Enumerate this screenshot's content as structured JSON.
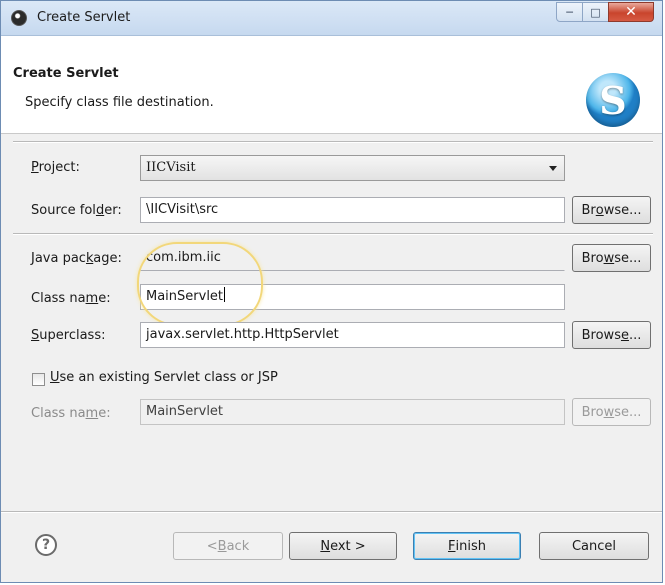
{
  "window": {
    "title": "Create Servlet"
  },
  "banner": {
    "title": "Create Servlet",
    "subtitle": "Specify class file destination.",
    "logo_letter": "S"
  },
  "form": {
    "project_label_pre": "",
    "project_label_u": "P",
    "project_label_post": "roject:",
    "project_value": "IICVisit",
    "source_folder_label_pre": "Source fol",
    "source_folder_label_u": "d",
    "source_folder_label_post": "er:",
    "source_folder_value": "\\IICVisit\\src",
    "java_package_label_pre": "Java pac",
    "java_package_label_u": "k",
    "java_package_label_post": "age:",
    "java_package_value": "com.ibm.iic",
    "class_name_label_pre": "Class na",
    "class_name_label_u": "m",
    "class_name_label_post": "e:",
    "class_name_value": "MainServlet",
    "superclass_label_pre": "",
    "superclass_label_u": "S",
    "superclass_label_post": "uperclass:",
    "superclass_value": "javax.servlet.http.HttpServlet",
    "existing_checkbox_label_u": "U",
    "existing_checkbox_label_post": "se an existing Servlet class or JSP",
    "existing_class_label_pre": "Class na",
    "existing_class_label_u": "m",
    "existing_class_label_post": "e:",
    "existing_class_value": "MainServlet",
    "browse_pre": "Br",
    "browse_u": "o",
    "browse_post": "wse...",
    "browse2_pre": "Bro",
    "browse2_u": "w",
    "browse2_post": "se...",
    "browse3_pre": "Brows",
    "browse3_u": "e",
    "browse3_post": "..."
  },
  "footer": {
    "help_glyph": "?",
    "back_pre": "< ",
    "back_u": "B",
    "back_post": "ack",
    "next_u": "N",
    "next_post": "ext >",
    "finish_u": "F",
    "finish_post": "inish",
    "cancel": "Cancel"
  },
  "colors": {
    "accent": "#3c7fb1",
    "highlight": "#f2d77a",
    "close": "#c9452d"
  },
  "icons": [
    "eclipse-app-icon",
    "minimize-icon",
    "maximize-icon",
    "close-icon",
    "servlet-logo-icon",
    "dropdown-arrow-icon",
    "help-icon"
  ]
}
